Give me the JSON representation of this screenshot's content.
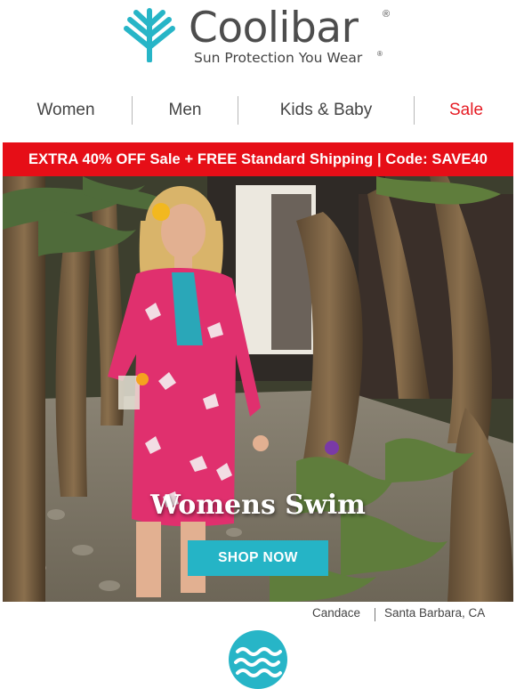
{
  "brand": {
    "name": "Coolibar",
    "registered": "®",
    "tagline": "Sun Protection You Wear",
    "tagline_registered": "®",
    "color": "#27b5c7"
  },
  "nav": {
    "items": [
      {
        "label": "Women",
        "color": "#444444"
      },
      {
        "label": "Men",
        "color": "#444444"
      },
      {
        "label": "Kids & Baby",
        "color": "#444444"
      },
      {
        "label": "Sale",
        "color": "#e61b23"
      }
    ]
  },
  "promo": {
    "text": "EXTRA 40% OFF Sale + FREE Standard Shipping | Code: SAVE40",
    "background": "#e60e17"
  },
  "hero": {
    "title": "Womens Swim",
    "cta_label": "SHOP NOW",
    "cta_color": "#25b4c6"
  },
  "credit": {
    "name": "Candace",
    "location": "Santa Barbara, CA"
  },
  "footer": {
    "icon": "waves-icon"
  }
}
